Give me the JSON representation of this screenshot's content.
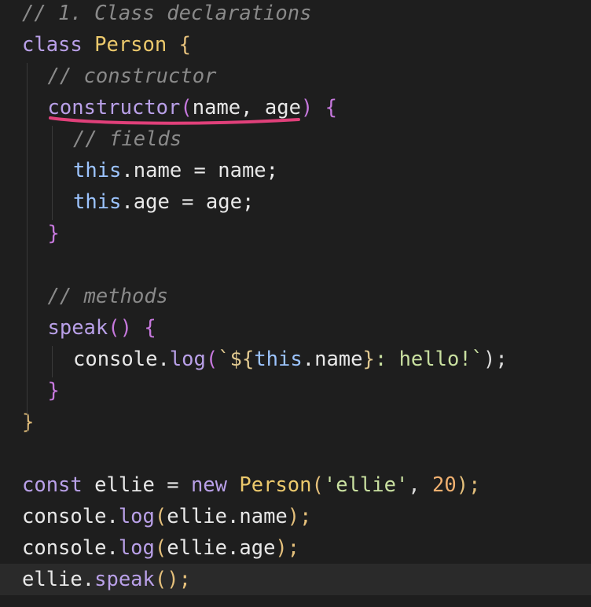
{
  "editor": {
    "lines": [
      {
        "id": "l1",
        "indent": 0,
        "tokens": [
          {
            "t": "// 1. Class declarations",
            "c": "cm"
          }
        ]
      },
      {
        "id": "l2",
        "indent": 0,
        "tokens": [
          {
            "t": "class ",
            "c": "kw"
          },
          {
            "t": "Person",
            "c": "cls"
          },
          {
            "t": " {",
            "c": "br"
          }
        ]
      },
      {
        "id": "l3",
        "indent": 1,
        "tokens": [
          {
            "t": "// constructor",
            "c": "cm"
          }
        ]
      },
      {
        "id": "l4",
        "indent": 1,
        "tokens": [
          {
            "t": "constructor",
            "c": "fn"
          },
          {
            "t": "(",
            "c": "br2"
          },
          {
            "t": "name, age",
            "c": "var"
          },
          {
            "t": ")",
            "c": "br2"
          },
          {
            "t": " {",
            "c": "br2"
          }
        ]
      },
      {
        "id": "l5",
        "indent": 2,
        "tokens": [
          {
            "t": "// fields",
            "c": "cm"
          }
        ]
      },
      {
        "id": "l6",
        "indent": 2,
        "tokens": [
          {
            "t": "this",
            "c": "thisk"
          },
          {
            "t": ".name = name;",
            "c": "prop"
          }
        ]
      },
      {
        "id": "l7",
        "indent": 2,
        "tokens": [
          {
            "t": "this",
            "c": "thisk"
          },
          {
            "t": ".age = age;",
            "c": "prop"
          }
        ]
      },
      {
        "id": "l8",
        "indent": 1,
        "tokens": [
          {
            "t": "}",
            "c": "br2"
          }
        ]
      },
      {
        "id": "l9",
        "indent": 0,
        "tokens": []
      },
      {
        "id": "l10",
        "indent": 1,
        "tokens": [
          {
            "t": "// methods",
            "c": "cm"
          }
        ]
      },
      {
        "id": "l11",
        "indent": 1,
        "tokens": [
          {
            "t": "speak",
            "c": "fn"
          },
          {
            "t": "()",
            "c": "br2"
          },
          {
            "t": " {",
            "c": "br2"
          }
        ]
      },
      {
        "id": "l12",
        "indent": 2,
        "tokens": [
          {
            "t": "console.",
            "c": "var"
          },
          {
            "t": "log",
            "c": "fn"
          },
          {
            "t": "(",
            "c": "br2"
          },
          {
            "t": "`${",
            "c": "tpl"
          },
          {
            "t": "this",
            "c": "thisk"
          },
          {
            "t": ".name",
            "c": "prop"
          },
          {
            "t": "}",
            "c": "tpl"
          },
          {
            "t": ": hello!`",
            "c": "str"
          },
          {
            "t": ");",
            "c": "punc"
          }
        ]
      },
      {
        "id": "l13",
        "indent": 1,
        "tokens": [
          {
            "t": "}",
            "c": "br2"
          }
        ]
      },
      {
        "id": "l14",
        "indent": 0,
        "tokens": [
          {
            "t": "}",
            "c": "br"
          }
        ]
      },
      {
        "id": "l15",
        "indent": 0,
        "tokens": []
      },
      {
        "id": "l16",
        "indent": 0,
        "tokens": [
          {
            "t": "const ",
            "c": "kw"
          },
          {
            "t": "ellie = ",
            "c": "var"
          },
          {
            "t": "new ",
            "c": "kw"
          },
          {
            "t": "Person",
            "c": "cls"
          },
          {
            "t": "(",
            "c": "br"
          },
          {
            "t": "'ellie'",
            "c": "str"
          },
          {
            "t": ", ",
            "c": "punc"
          },
          {
            "t": "20",
            "c": "num"
          },
          {
            "t": ");",
            "c": "br"
          }
        ]
      },
      {
        "id": "l17",
        "indent": 0,
        "tokens": [
          {
            "t": "console.",
            "c": "var"
          },
          {
            "t": "log",
            "c": "fn"
          },
          {
            "t": "(",
            "c": "br"
          },
          {
            "t": "ellie.name",
            "c": "var"
          },
          {
            "t": ");",
            "c": "br"
          }
        ]
      },
      {
        "id": "l18",
        "indent": 0,
        "tokens": [
          {
            "t": "console.",
            "c": "var"
          },
          {
            "t": "log",
            "c": "fn"
          },
          {
            "t": "(",
            "c": "br"
          },
          {
            "t": "ellie.age",
            "c": "var"
          },
          {
            "t": ");",
            "c": "br"
          }
        ]
      },
      {
        "id": "l19",
        "indent": 0,
        "current": true,
        "tokens": [
          {
            "t": "ellie.",
            "c": "var"
          },
          {
            "t": "speak",
            "c": "fn"
          },
          {
            "t": "();",
            "c": "br"
          }
        ]
      }
    ]
  },
  "colors": {
    "background": "#1e1e1e",
    "underline": "#e0407a"
  }
}
